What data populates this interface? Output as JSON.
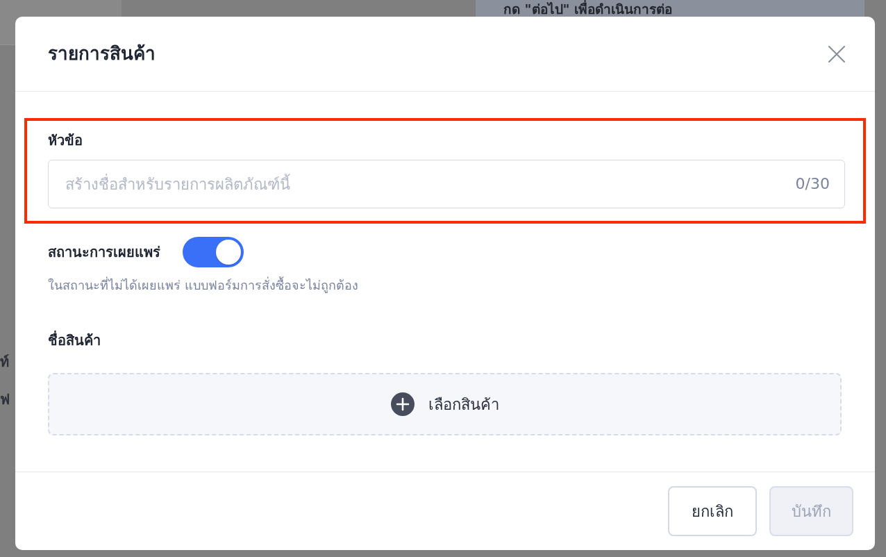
{
  "background": {
    "banner_text": "กด \"ต่อไป\" เพื่อดำเนินการต่อ",
    "side_texts": [
      "ท์",
      "ฟ"
    ]
  },
  "dialog": {
    "title": "รายการสินค้า"
  },
  "title_field": {
    "label": "หัวข้อ",
    "placeholder": "สร้างชื่อสำหรับรายการผลิตภัณฑ์นี้",
    "counter": "0/30",
    "highlighted": true
  },
  "publish_status": {
    "label": "สถานะการเผยแพร่",
    "on": true,
    "hint": "ในสถานะที่ไม่ได้เผยแพร่ แบบฟอร์มการสั่งซื้อจะไม่ถูกต้อง"
  },
  "product_name": {
    "label": "ชื่อสินค้า",
    "add_button": "เลือกสินค้า"
  },
  "buttons": [
    {
      "label": "ยกเลิก",
      "kind": "cancel",
      "disabled": false
    },
    {
      "label": "บันทึก",
      "kind": "save",
      "disabled": true
    }
  ]
}
